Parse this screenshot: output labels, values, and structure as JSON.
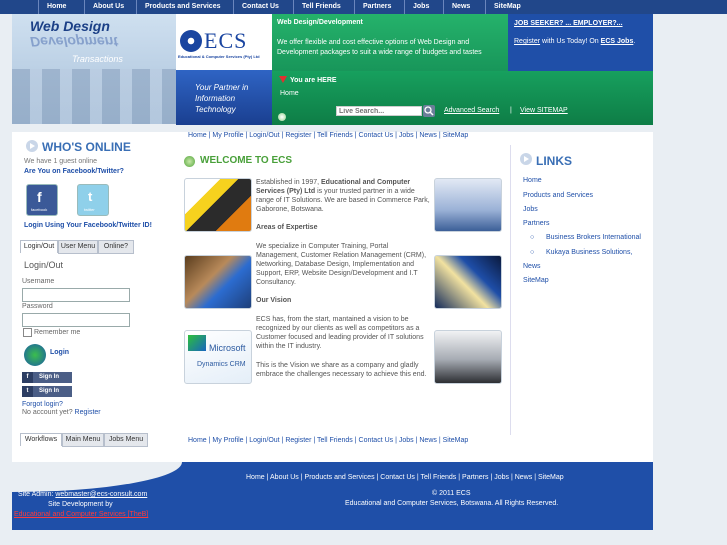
{
  "topnav": [
    "Home",
    "About Us",
    "Products and Services",
    "Contact Us",
    "Tell Friends",
    "Partners",
    "Jobs",
    "News",
    "SiteMap"
  ],
  "header": {
    "banner_line1": "Web Design",
    "banner_line2": "Development",
    "banner_line3": "Transactions",
    "company_logo": "ECS",
    "company_sub": "Educational & Computer Services (Pty) Ltd",
    "slogan_1": "Your Partner in",
    "slogan_2": "Information",
    "slogan_3": "Technology",
    "green_title": "Web Design/Development",
    "green_desc": "We offer flexible and cost effective options of Web Design and Development packages to suit a wide range of budgets and tastes",
    "jobs_line": "JOB SEEKER? ... EMPLOYER?...",
    "register_prefix": "Register",
    "register_mid": " with Us Today! On ",
    "register_link": "ECS Jobs",
    "register_end": ".",
    "you_are_here": "You are HERE",
    "crumb_home": "Home",
    "search_placeholder": "Live Search...",
    "advanced_search": "Advanced Search",
    "pipe": "|",
    "view_sitemap": "View SITEMAP"
  },
  "left": {
    "who_title": "WHO'S ONLINE",
    "guests": "We have 1 guest online",
    "social_q": "Are You on Facebook/Twitter?",
    "facebook_label": "facebook",
    "twitter_label": "twitter",
    "login_social": "Login Using Your Facebook/Twitter ID!",
    "tabs": [
      "Login/Out",
      "User Menu",
      "Online?"
    ],
    "login_title": "Login/Out",
    "username_label": "Username",
    "password_label": "Password",
    "remember_label": "Remember me",
    "login_button": "Login",
    "fb_signin": "Sign In",
    "tw_signin": "Sign In",
    "forgot": "Forgot login?",
    "no_account": "No account yet?",
    "register": "Register",
    "bottom_tabs": [
      "Workflows",
      "Main Menu",
      "Jobs Menu"
    ]
  },
  "crumbs": [
    "Home",
    "My Profile",
    "Login/Out",
    "Register",
    "Tell Friends",
    "Contact Us",
    "Jobs",
    "News",
    "SiteMap"
  ],
  "main": {
    "welcome": "WELCOME TO ECS",
    "p1_a": "Established in 1997, ",
    "p1_b": "Educational and Computer Services (Pty) Ltd",
    "p1_c": " is your trusted partner in a wide range of IT Solutions. We are based in Commerce Park, Gaborone, Botswana.",
    "areas_title": "Areas of Expertise",
    "p2": "We specialize in Computer Training, Portal Management, Customer Relation Management (CRM), Networking, Database Design, Implementation and Support, ERP, Website Design/Development and I.T Consultancy.",
    "vision_title": "Our Vision",
    "p3": "ECS has, from the start, mantained a vision to be recognized by our clients as well as competitors as a Customer focused and leading provider of IT solutions within the IT industry.",
    "p4": "This is the Vision we share as a company and gladly embrace the challenges necessary to achieve this end.",
    "ms_line1": "Microsoft",
    "ms_line2": "Dynamics CRM"
  },
  "links": {
    "title": "LINKS",
    "items": [
      "Home",
      "Products and Services",
      "Jobs",
      "Partners",
      "Business Brokers International",
      "Kukaya Business Solutions,",
      "News",
      "SiteMap"
    ]
  },
  "footer": {
    "admin_prefix": "Site Admin: ",
    "admin_email": "webmaster@ecs-consult.com",
    "dev_by": "Site Development by",
    "dev_company": "Educational and Computer Services [TheB]",
    "nav": [
      "Home",
      "About Us",
      "Products and Services",
      "Contact Us",
      "Tell Friends",
      "Partners",
      "Jobs",
      "News",
      "SiteMap"
    ],
    "copyright": "© 2011 ECS",
    "rights": "Educational and Computer Services, Botswana. All Rights Reserved."
  }
}
